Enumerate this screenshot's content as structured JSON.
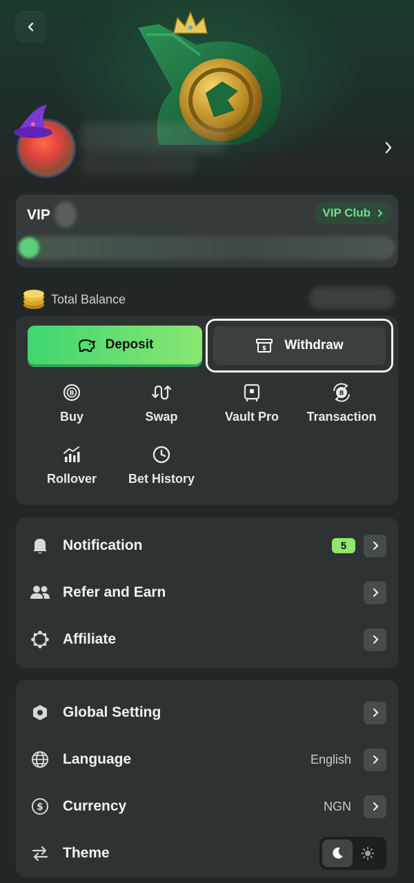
{
  "profile": {
    "back_icon": "chevron-left-icon",
    "forward_icon": "chevron-right-icon"
  },
  "vip": {
    "label": "VIP",
    "club_label": "VIP Club"
  },
  "balance": {
    "label": "Total Balance"
  },
  "wallet": {
    "deposit_label": "Deposit",
    "withdraw_label": "Withdraw",
    "actions": [
      {
        "label": "Buy",
        "icon": "bitcoin-coin-icon"
      },
      {
        "label": "Swap",
        "icon": "swap-arrows-icon"
      },
      {
        "label": "Vault Pro",
        "icon": "vault-icon"
      },
      {
        "label": "Transaction",
        "icon": "transaction-icon"
      },
      {
        "label": "Rollover",
        "icon": "rollover-chart-icon"
      },
      {
        "label": "Bet History",
        "icon": "clock-icon"
      }
    ]
  },
  "menu1": [
    {
      "label": "Notification",
      "icon": "bell-icon",
      "badge": "5"
    },
    {
      "label": "Refer and Earn",
      "icon": "users-icon"
    },
    {
      "label": "Affiliate",
      "icon": "affiliate-icon"
    }
  ],
  "menu2": [
    {
      "label": "Global Setting",
      "icon": "settings-hex-icon"
    },
    {
      "label": "Language",
      "icon": "globe-icon",
      "value": "English"
    },
    {
      "label": "Currency",
      "icon": "dollar-circle-icon",
      "value": "NGN"
    },
    {
      "label": "Theme",
      "icon": "arrows-swap-icon"
    }
  ],
  "colors": {
    "accent_green": "#5ad17a",
    "background": "#232626",
    "card": "#2e3232"
  }
}
